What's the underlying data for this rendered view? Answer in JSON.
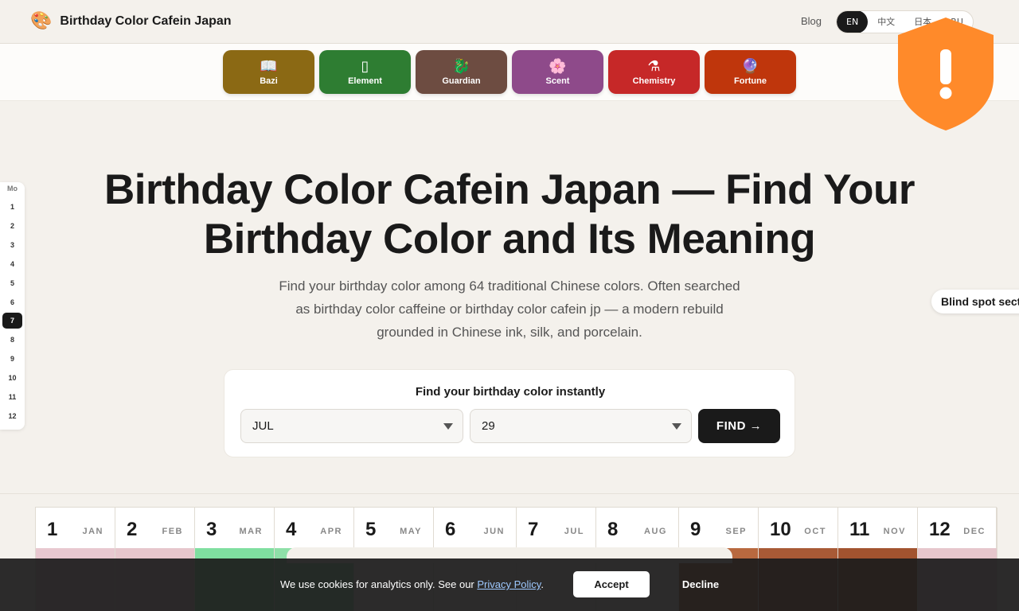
{
  "header": {
    "brand_icon": "🎨",
    "brand_name": "Birthday Color Cafein Japan",
    "blog_label": "Blog",
    "languages": [
      "EN",
      "中文",
      "日本",
      "RU"
    ],
    "active_language": "EN"
  },
  "categories": [
    {
      "label": "Bazi",
      "icon": "📖",
      "icon_name": "book-icon",
      "color": "#8b6914"
    },
    {
      "label": "Element",
      "icon": "▯",
      "icon_name": "element-icon",
      "color": "#2e7d32"
    },
    {
      "label": "Guardian",
      "icon": "🐉",
      "icon_name": "dragon-icon",
      "color": "#6d4c41"
    },
    {
      "label": "Scent",
      "icon": "🌸",
      "icon_name": "blossom-icon",
      "color": "#8e4a8a"
    },
    {
      "label": "Chemistry",
      "icon": "⚗",
      "icon_name": "flask-icon",
      "color": "#c62828"
    },
    {
      "label": "Fortune",
      "icon": "🔮",
      "icon_name": "crystal-ball-icon",
      "color": "#bf360c"
    }
  ],
  "alert_shield": {
    "glyph": "!",
    "color": "#ff8a2a"
  },
  "month_rail": {
    "header": "Mo",
    "items": [
      "1",
      "2",
      "3",
      "4",
      "5",
      "6",
      "7",
      "8",
      "9",
      "10",
      "11",
      "12"
    ],
    "active": "7"
  },
  "hero": {
    "title_line1": "Birthday Color Cafein Japan — Find Your",
    "title_line2": "Birthday Color and Its Meaning",
    "subtitle": "Find your birthday color among 64 traditional Chinese colors. Often searched as birthday color caffeine or birthday color cafein jp — a modern rebuild grounded in Chinese ink, silk, and porcelain."
  },
  "blind_spot_tab": "Blind spot sect",
  "finder": {
    "title": "Find your birthday color instantly",
    "month_value": "JUL",
    "day_value": "29",
    "find_label": "FIND →"
  },
  "months": [
    {
      "num": "1",
      "abbr": "JAN",
      "swatch": "#e8c8d0"
    },
    {
      "num": "2",
      "abbr": "FEB",
      "swatch": "#e6c6cc"
    },
    {
      "num": "3",
      "abbr": "MAR",
      "swatch": "#7fdfa0"
    },
    {
      "num": "4",
      "abbr": "APR",
      "swatch": "#8ee0a8"
    },
    {
      "num": "5",
      "abbr": "MAY",
      "swatch": "#f3f0ea"
    },
    {
      "num": "6",
      "abbr": "JUN",
      "swatch": "#f3f0ea"
    },
    {
      "num": "7",
      "abbr": "JUL",
      "swatch": "#f3f0ea"
    },
    {
      "num": "8",
      "abbr": "AUG",
      "swatch": "#f3f0ea"
    },
    {
      "num": "9",
      "abbr": "SEP",
      "swatch": "#b8693f"
    },
    {
      "num": "10",
      "abbr": "OCT",
      "swatch": "#a85a36"
    },
    {
      "num": "11",
      "abbr": "NOV",
      "swatch": "#a2532f"
    },
    {
      "num": "12",
      "abbr": "DEC",
      "swatch": "#e6c6cc"
    }
  ],
  "cookie": {
    "text_before": "We use cookies for analytics only. See our ",
    "link_label": "Privacy Policy",
    "text_after": ".",
    "accept_label": "Accept",
    "decline_label": "Decline"
  }
}
